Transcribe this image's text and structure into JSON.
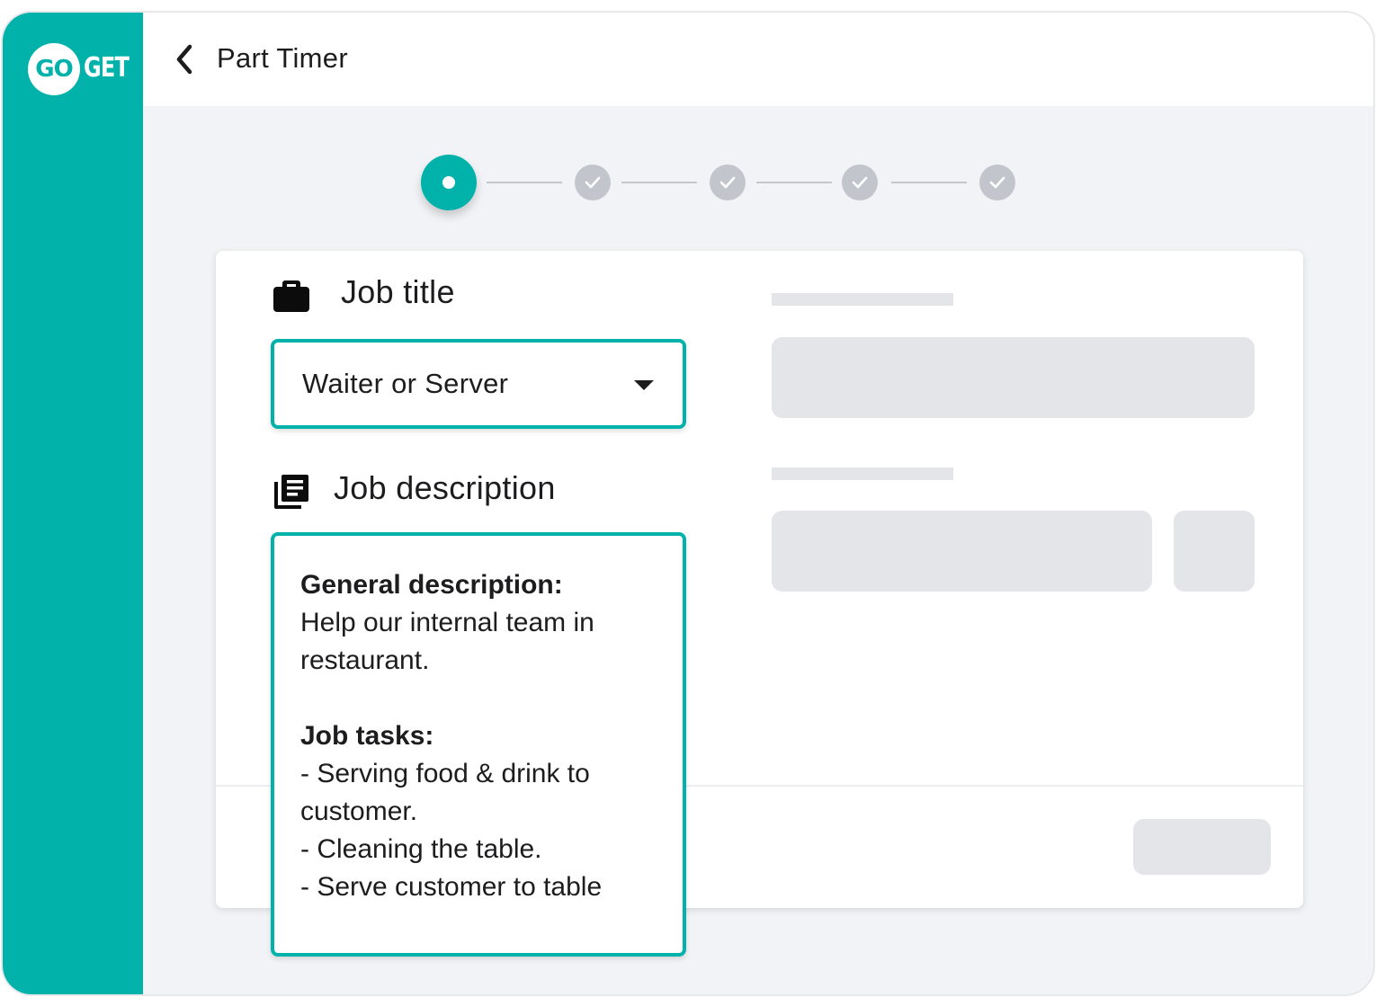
{
  "app": {
    "logo_go": "GO",
    "logo_get": "GET"
  },
  "header": {
    "title": "Part Timer"
  },
  "stepper": {
    "steps": [
      "active",
      "done",
      "done",
      "done",
      "done"
    ]
  },
  "job_title": {
    "label": "Job title",
    "selected_value": "Waiter or Server"
  },
  "job_description": {
    "label": "Job description",
    "general_heading": "General description:",
    "general_lines": [
      "Help our internal team in",
      "restaurant."
    ],
    "tasks_heading": "Job tasks:",
    "task_lines": [
      "- Serving food & drink to",
      "customer.",
      "- Cleaning the table.",
      "- Serve customer to table"
    ]
  },
  "colors": {
    "brand": "#00b2aa",
    "background": "#f1f3f6",
    "placeholder": "#e3e5e9",
    "step_done": "#c2c6cc"
  },
  "icons": [
    "back-arrow-icon",
    "briefcase-icon",
    "library-books-icon",
    "caret-down-icon",
    "check-icon"
  ]
}
